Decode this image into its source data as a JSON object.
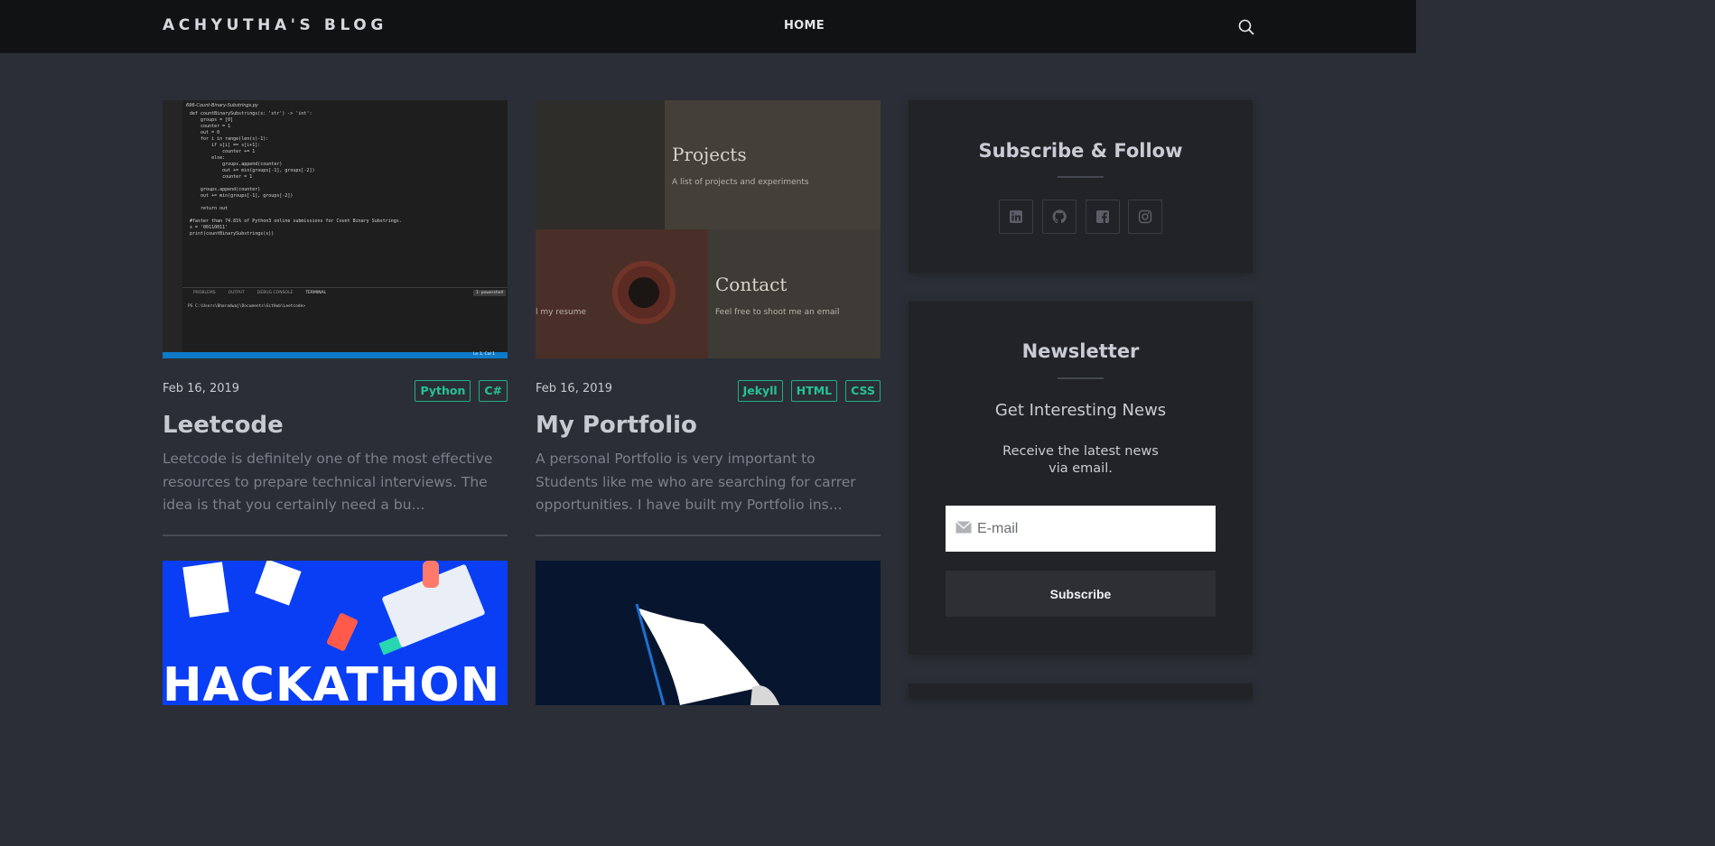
{
  "nav": {
    "brand": "ACHYUTHA'S BLOG",
    "home": "HOME",
    "search_icon": "search-icon"
  },
  "posts": [
    {
      "date": "Feb 16, 2019",
      "tags": [
        "Python",
        "C#"
      ],
      "title": "Leetcode",
      "excerpt": "Leetcode is definitely one of the most effective resources to prepare technical interviews. The idea is that you certainly need a bu...",
      "thumb": {
        "tab": "696-Count-Binary-Substrings.py",
        "code": "def countBinarySubstrings(s: 'str') -> 'int':\n    groups = [0]\n    counter = 1\n    out = 0\n    for i in range(len(s)-1):\n        if s[i] == s[i+1]:\n            counter += 1\n        else:\n            groups.append(counter)\n            out += min(groups[-1], groups[-2])\n            counter = 1\n\n    groups.append(counter)\n    out += min(groups[-1], groups[-2])\n\n    return out\n\n#faster than 74.81% of Python3 online submissions for Count Binary Substrings.\ns = '00110011'\nprint(countBinarySubstrings(s))",
        "terminal_tabs": [
          "PROBLEMS",
          "OUTPUT",
          "DEBUG CONSOLE",
          "TERMINAL"
        ],
        "terminal_shell": "1: powershell",
        "terminal_line": "PS C:\\Users\\Bharadwaj\\Documents\\GitHub\\Leetcode>",
        "status": "Ln 1, Col 1"
      }
    },
    {
      "date": "Feb 16, 2019",
      "tags": [
        "Jekyll",
        "HTML",
        "CSS"
      ],
      "title": "My Portfolio",
      "excerpt": "A personal Portfolio is very important to Students like me who are searching for carrer opportunities. I have built my Portfolio ins...",
      "thumb": {
        "projects_title": "Projects",
        "projects_sub": "A list of projects and experiments",
        "resume_sub": "l my resume",
        "contact_title": "Contact",
        "contact_sub": "Feel free to shoot me an email"
      }
    },
    {
      "thumb": {
        "word": "HACKATHON"
      }
    },
    {
      "thumb": {}
    }
  ],
  "sidebar": {
    "follow": {
      "title": "Subscribe & Follow",
      "icons": [
        "linkedin-icon",
        "github-icon",
        "facebook-icon",
        "instagram-icon"
      ]
    },
    "newsletter": {
      "title": "Newsletter",
      "subtitle": "Get Interesting News",
      "description": "Receive the latest news via email.",
      "email_placeholder": "E-mail",
      "email_icon": "mail-icon",
      "button": "Subscribe"
    }
  },
  "colors": {
    "background": "#2b2e36",
    "nav": "#111214",
    "widget": "#222327",
    "tag_accent": "#26c294",
    "hackathon_blue": "#0a3ef5"
  }
}
